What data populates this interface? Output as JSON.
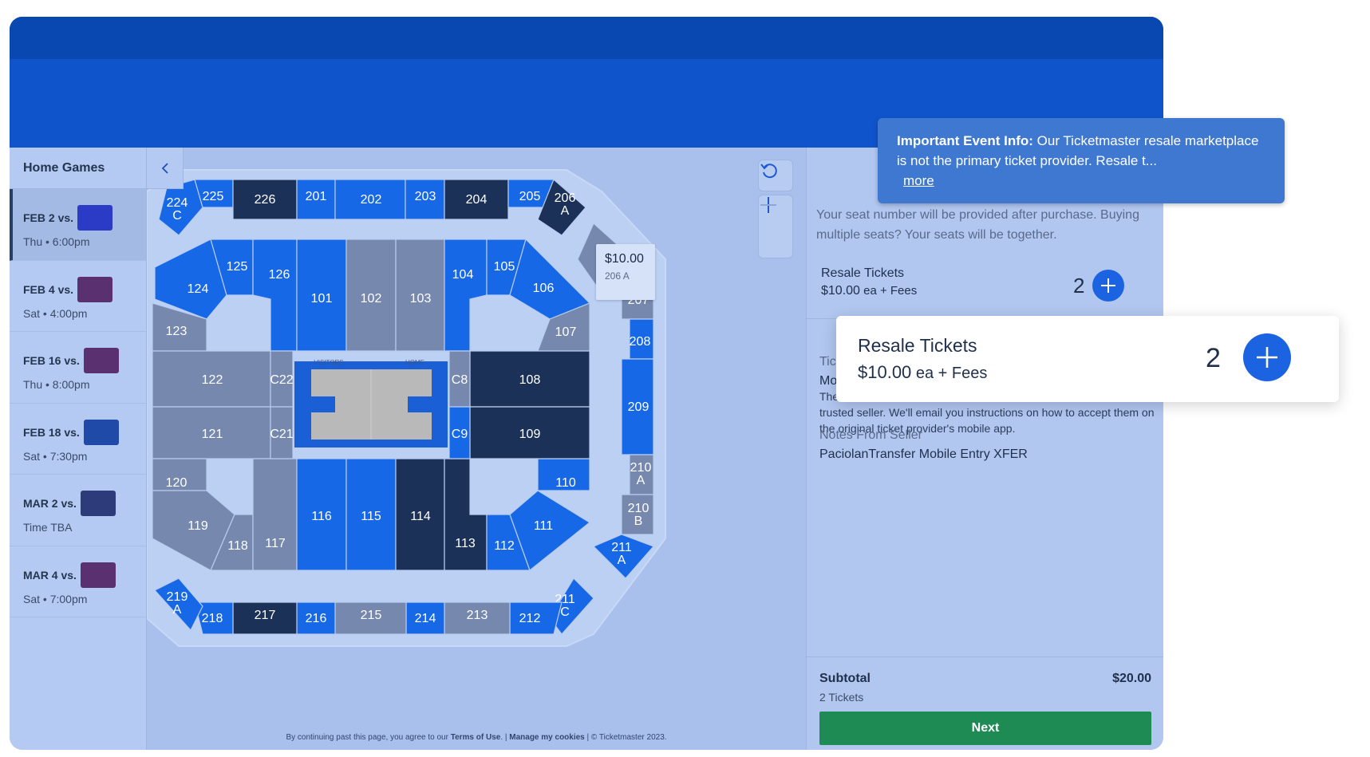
{
  "sidebar": {
    "title": "Home Games",
    "games": [
      {
        "title": "FEB 2 vs.",
        "sub": "Thu • 6:00pm",
        "thumb": "#2b3bc6"
      },
      {
        "title": "FEB 4 vs.",
        "sub": "Sat • 4:00pm",
        "thumb": "#5a3070"
      },
      {
        "title": "FEB 16 vs.",
        "sub": "Thu • 8:00pm",
        "thumb": "#5a3070"
      },
      {
        "title": "FEB 18 vs.",
        "sub": "Sat • 7:30pm",
        "thumb": "#1f4aa8"
      },
      {
        "title": "MAR 2 vs.",
        "sub": "Time TBA",
        "thumb": "#2e3b7a"
      },
      {
        "title": "MAR 4 vs.",
        "sub": "Sat • 7:00pm",
        "thumb": "#5a3070"
      }
    ]
  },
  "map": {
    "tooltip_price": "$10.00",
    "tooltip_section": "206 A",
    "court_labels": {
      "visitors": "VISITORS",
      "home": "HOME"
    },
    "footer": {
      "prefix": "By continuing past this page, you agree to our ",
      "terms": "Terms of Use",
      "sep": ". | ",
      "cookies": "Manage my cookies",
      "suffix": " | © Ticketmaster 2023."
    }
  },
  "panel": {
    "info": "Your seat number will be provided after purchase. Buying multiple seats? Your seats will be together.",
    "row_label": "Resale Tickets",
    "row_price": "$10.00",
    "row_price_suffix": " ea + Fees",
    "row_qty": "2",
    "ticket_type_label": "Ticke",
    "ticket_type_value": "Mobi",
    "desc_prefix": "These",
    "desc_body": "trusted seller. We'll email you instructions on how to accept them on the original ticket provider's mobile app.",
    "notes_label": "Notes From Seller",
    "notes_value": "PaciolanTransfer Mobile Entry XFER",
    "subtotal_label": "Subtotal",
    "subtotal_amount": "$20.00",
    "subtotal_count": "2 Tickets",
    "next_label": "Next"
  },
  "banner": {
    "bold": "Important Event Info:",
    "text": " Our Ticketmaster resale marketplace is not the primary ticket provider. Resale t...",
    "more": "more"
  },
  "zoom": {
    "label": "Resale Tickets",
    "price": "$10.00",
    "price_suffix": " ea + Fees",
    "qty": "2"
  },
  "colors": {
    "light": "#1768e6",
    "gray": "#7688ad",
    "dark": "#1c3157",
    "accent_green": "#1e8a54"
  }
}
